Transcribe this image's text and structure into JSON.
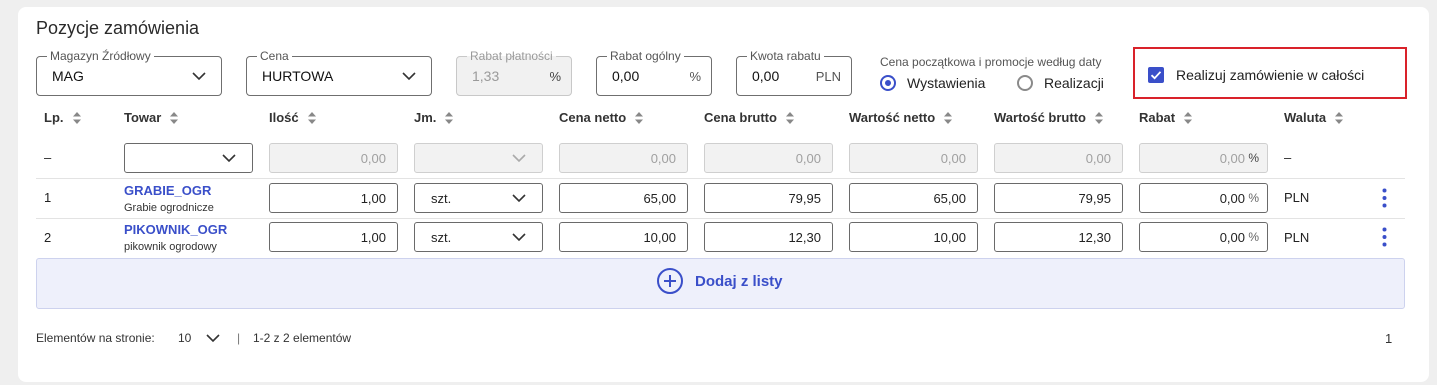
{
  "title": "Pozycje zamówienia",
  "filters": {
    "magazyn": {
      "label": "Magazyn Źródłowy",
      "value": "MAG"
    },
    "cena": {
      "label": "Cena",
      "value": "HURTOWA"
    },
    "rabat_platnosci": {
      "label": "Rabat płatności",
      "value": "1,33",
      "unit": "%"
    },
    "rabat_ogolny": {
      "label": "Rabat ogólny",
      "value": "0,00",
      "unit": "%"
    },
    "kwota_rabatu": {
      "label": "Kwota rabatu",
      "value": "0,00",
      "unit": "PLN"
    }
  },
  "price_date": {
    "label": "Cena początkowa i promocje według daty",
    "options": [
      "Wystawienia",
      "Realizacji"
    ],
    "selected": "Wystawienia"
  },
  "realize_full": {
    "label": "Realizuj zamówienie w całości",
    "checked": true
  },
  "columns": [
    "Lp.",
    "Towar",
    "Ilość",
    "Jm.",
    "Cena netto",
    "Cena brutto",
    "Wartość netto",
    "Wartość brutto",
    "Rabat",
    "Waluta"
  ],
  "new_row": {
    "lp": "–",
    "ilosc": "0,00",
    "cena_netto": "0,00",
    "cena_brutto": "0,00",
    "wartosc_netto": "0,00",
    "wartosc_brutto": "0,00",
    "rabat": "0,00",
    "rabat_unit": "%",
    "waluta": "–"
  },
  "rows": [
    {
      "lp": "1",
      "code": "GRABIE_OGR",
      "name": "Grabie ogrodnicze",
      "ilosc": "1,00",
      "jm": "szt.",
      "cena_netto": "65,00",
      "cena_brutto": "79,95",
      "wartosc_netto": "65,00",
      "wartosc_brutto": "79,95",
      "rabat": "0,00",
      "rabat_unit": "%",
      "waluta": "PLN"
    },
    {
      "lp": "2",
      "code": "PIKOWNIK_OGR",
      "name": "pikownik ogrodowy",
      "ilosc": "1,00",
      "jm": "szt.",
      "cena_netto": "10,00",
      "cena_brutto": "12,30",
      "wartosc_netto": "10,00",
      "wartosc_brutto": "12,30",
      "rabat": "0,00",
      "rabat_unit": "%",
      "waluta": "PLN"
    }
  ],
  "add_label": "Dodaj z listy",
  "pager": {
    "label": "Elementów na stronie:",
    "page_size": "10",
    "separator": "|",
    "range": "1-2 z 2 elementów",
    "page": "1"
  },
  "colors": {
    "accent": "#3a4fc9",
    "highlight": "#d9222a"
  }
}
